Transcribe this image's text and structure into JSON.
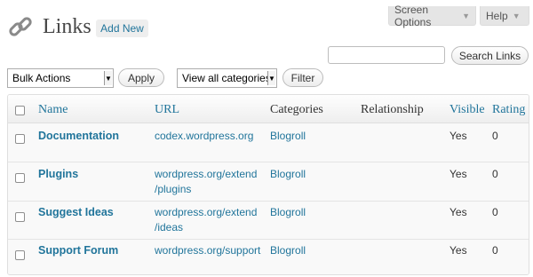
{
  "top_tabs": {
    "screen_options": "Screen Options",
    "help": "Help",
    "caret": "▼"
  },
  "header": {
    "title": "Links",
    "add_new": "Add New",
    "icon": "links-chain-icon"
  },
  "search": {
    "value": "",
    "button": "Search Links"
  },
  "bulk_actions": {
    "selected": "Bulk Actions",
    "apply": "Apply"
  },
  "category_filter": {
    "selected": "View all categories",
    "filter": "Filter"
  },
  "table": {
    "columns": {
      "name": "Name",
      "url": "URL",
      "categories": "Categories",
      "relationship": "Relationship",
      "visible": "Visible",
      "rating": "Rating"
    },
    "rows": [
      {
        "name": "Documentation",
        "url": [
          "codex.wordpress.org"
        ],
        "categories": "Blogroll",
        "relationship": "",
        "visible": "Yes",
        "rating": "0"
      },
      {
        "name": "Plugins",
        "url": [
          "wordpress.org/extend",
          "/plugins"
        ],
        "categories": "Blogroll",
        "relationship": "",
        "visible": "Yes",
        "rating": "0"
      },
      {
        "name": "Suggest Ideas",
        "url": [
          "wordpress.org/extend",
          "/ideas"
        ],
        "categories": "Blogroll",
        "relationship": "",
        "visible": "Yes",
        "rating": "0"
      },
      {
        "name": "Support Forum",
        "url": [
          "wordpress.org/support"
        ],
        "categories": "Blogroll",
        "relationship": "",
        "visible": "Yes",
        "rating": "0"
      }
    ]
  },
  "colors": {
    "link": "#21759b",
    "header_bg": "#eeeeee",
    "row_bg": "#f9f9f9"
  }
}
